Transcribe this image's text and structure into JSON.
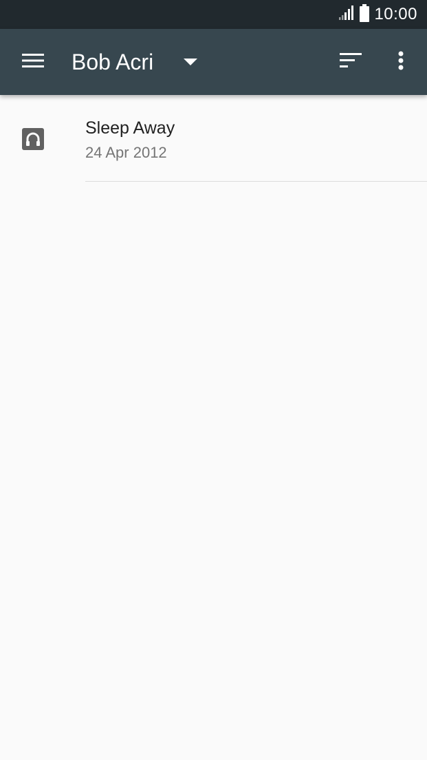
{
  "status_bar": {
    "time": "10:00",
    "icons": [
      "signal-icon",
      "battery-icon"
    ]
  },
  "app_bar": {
    "title": "Bob Acri",
    "icons": [
      "menu-icon",
      "dropdown-arrow-icon",
      "sort-icon",
      "more-vert-icon"
    ]
  },
  "list": {
    "items": [
      {
        "title": "Sleep Away",
        "subtitle": "24 Apr 2012",
        "icon": "headphones-icon"
      }
    ]
  },
  "colors": {
    "status_bar_bg": "#21292e",
    "app_bar_bg": "#37474f",
    "background": "#fafafa",
    "primary_text": "#212121",
    "secondary_text": "#757575",
    "icon_gray": "#616161"
  }
}
